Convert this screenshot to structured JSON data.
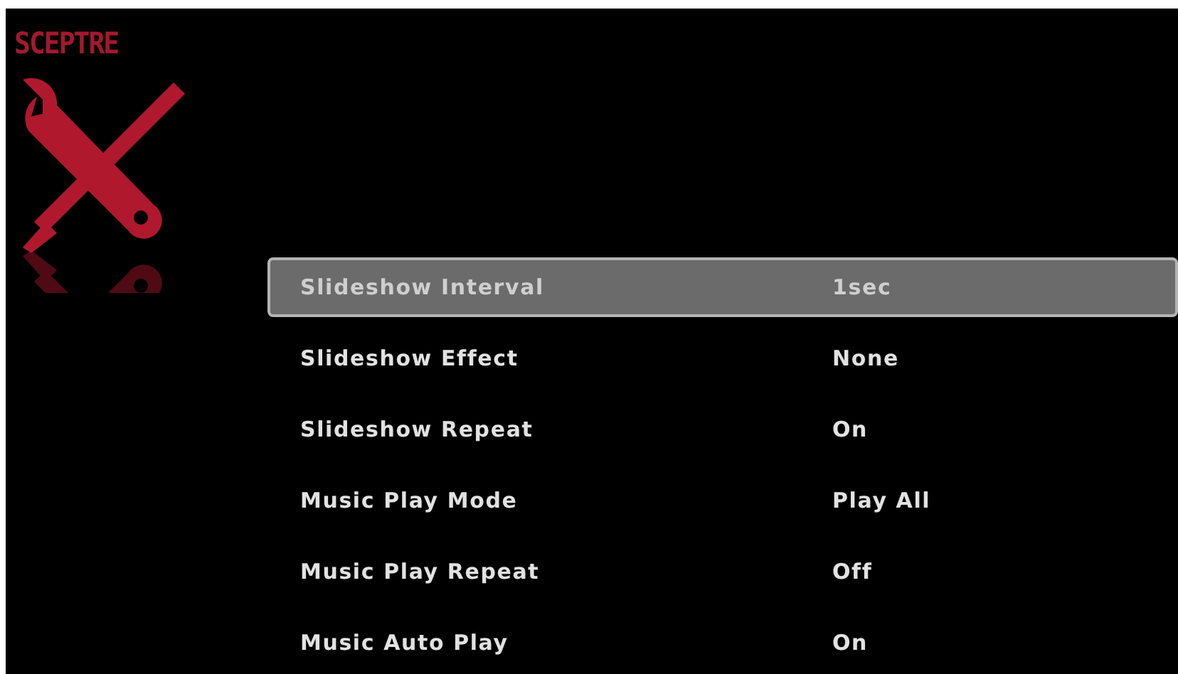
{
  "brand": {
    "logo_text": "SCEPTRE"
  },
  "settings": [
    {
      "label": "Slideshow Interval",
      "value": "1sec",
      "selected": true
    },
    {
      "label": "Slideshow Effect",
      "value": "None",
      "selected": false
    },
    {
      "label": "Slideshow Repeat",
      "value": "On",
      "selected": false
    },
    {
      "label": "Music Play Mode",
      "value": "Play All",
      "selected": false
    },
    {
      "label": "Music Play Repeat",
      "value": "Off",
      "selected": false
    },
    {
      "label": "Music Auto Play",
      "value": "On",
      "selected": false
    }
  ]
}
